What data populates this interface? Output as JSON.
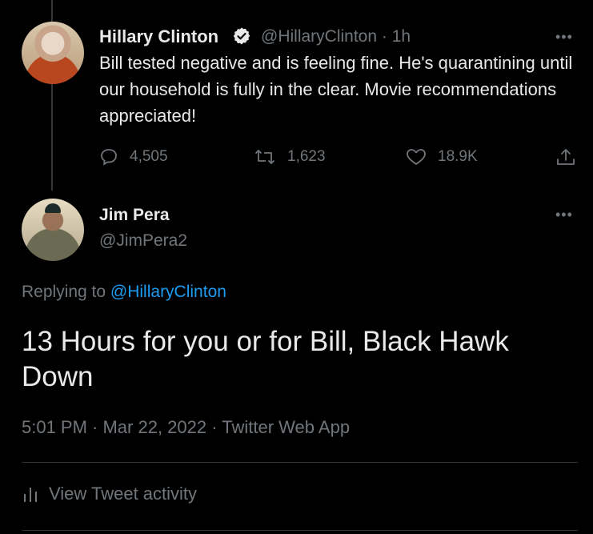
{
  "parent_tweet": {
    "author_name": "Hillary Clinton",
    "handle": "@HillaryClinton",
    "time": "· 1h",
    "text": "Bill tested negative and is feeling fine. He's quarantining until our household is fully in the clear. Movie recommendations appreciated!",
    "replies": "4,505",
    "retweets": "1,623",
    "likes": "18.9K",
    "more": "•••"
  },
  "reply_tweet": {
    "author_name": "Jim Pera",
    "handle": "@JimPera2",
    "more": "•••",
    "replying_prefix": "Replying to",
    "replying_handle": "@HillaryClinton",
    "text": "13 Hours for you or for Bill, Black Hawk Down",
    "meta": "5:01 PM · Mar 22, 2022 · Twitter Web App",
    "activity_label": "View Tweet activity"
  },
  "colors": {
    "background": "#000000",
    "text": "#e7e9ea",
    "muted": "#71767b",
    "link": "#1d9bf0",
    "verified": "#e7e9ea"
  }
}
